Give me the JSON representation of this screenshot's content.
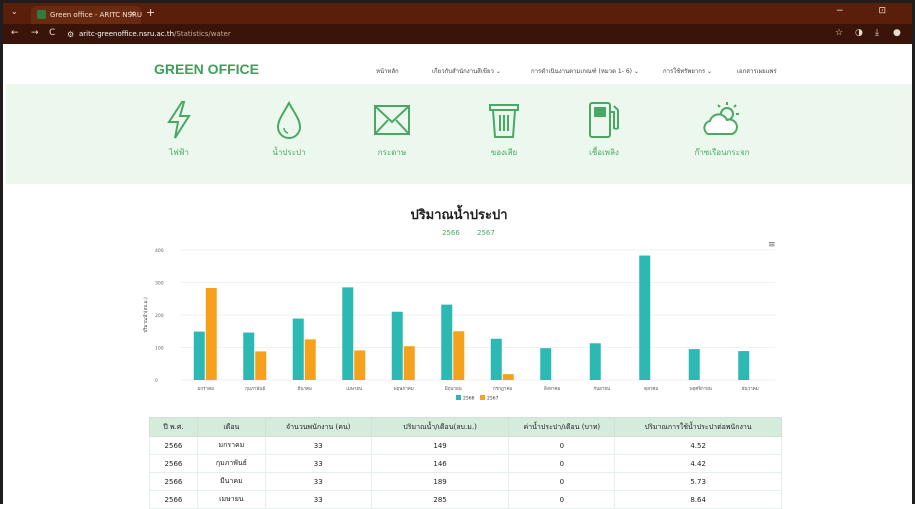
{
  "browser": {
    "tab_title": "Green office - ARITC NSRU",
    "tab_close": "×",
    "new_tab": "+",
    "tab_menu": "⌄",
    "window_buttons": "− ⊡",
    "back": "←",
    "forward": "→",
    "reload": "C",
    "url_host": "aritc-greenoffice.nsru.ac.th",
    "url_path": "/Statistics/water",
    "icons": [
      "star-icon",
      "extension-icon",
      "download-icon",
      "profile-icon"
    ]
  },
  "site": {
    "logo": "GREEN OFFICE",
    "nav": [
      {
        "label": "หน้าหลัก"
      },
      {
        "label": "เกี่ยวกับสำนักงานสีเขียว ⌄"
      },
      {
        "label": "การดำเนินงานตามเกณฑ์ (หมวด 1- 6) ⌄"
      },
      {
        "label": "การใช้ทรัพยากร ⌄"
      },
      {
        "label": "เอกสารเผยแพร่"
      }
    ],
    "categories": [
      {
        "label": "ไฟฟ้า",
        "icon": "lightning-icon"
      },
      {
        "label": "น้ำประปา",
        "icon": "water-drop-icon"
      },
      {
        "label": "กระดาษ",
        "icon": "paper-envelope-icon"
      },
      {
        "label": "ของเสีย",
        "icon": "trash-bin-icon"
      },
      {
        "label": "เชื้อเพลิง",
        "icon": "fuel-pump-icon"
      },
      {
        "label": "ก๊าซเรือนกระจก",
        "icon": "sun-cloud-icon"
      }
    ],
    "accent": "#4aa865",
    "band_color": "#ecf8ee"
  },
  "chart_header": {
    "title": "ปริมาณน้ำประปา",
    "year_a": "2566",
    "year_b": "2567",
    "menu_icon": "≡"
  },
  "chart_data": {
    "type": "bar",
    "categories": [
      "มกราคม",
      "กุมภาพันธ์",
      "มีนาคม",
      "เมษายน",
      "พฤษภาคม",
      "มิถุนายน",
      "กรกฎาคม",
      "สิงหาคม",
      "กันยายน",
      "ตุลาคม",
      "พฤศจิกายน",
      "ธันวาคม"
    ],
    "series": [
      {
        "name": "2566",
        "color": "#2cb8b3",
        "values": [
          149,
          146,
          189,
          285,
          210,
          232,
          127,
          98,
          113,
          383,
          95,
          89
        ]
      },
      {
        "name": "2567",
        "color": "#f5a11c",
        "values": [
          283,
          88,
          125,
          91,
          104,
          150,
          18,
          null,
          null,
          null,
          null,
          null
        ]
      }
    ],
    "ylabel": "ปริมาณน้ำ(ลบ.ม.)",
    "ylim": [
      0,
      400
    ],
    "yticks": [
      0,
      100,
      200,
      300,
      400
    ],
    "grid": true,
    "legend": "bottom"
  },
  "table": {
    "headers": [
      "ปี พ.ศ.",
      "เดือน",
      "จำนวนพนักงาน (คน)",
      "ปริมาณน้ำ/เดือน(ลบ.ม.)",
      "ค่าน้ำประปา/เดือน (บาท)",
      "ปริมาณการใช้น้ำประปาต่อพนักงาน"
    ],
    "rows": [
      [
        "2566",
        "มกราคม",
        "33",
        "149",
        "0",
        "4.52"
      ],
      [
        "2566",
        "กุมภาพันธ์",
        "33",
        "146",
        "0",
        "4.42"
      ],
      [
        "2566",
        "มีนาคม",
        "33",
        "189",
        "0",
        "5.73"
      ],
      [
        "2566",
        "เมษายน",
        "33",
        "285",
        "0",
        "8.64"
      ]
    ]
  }
}
